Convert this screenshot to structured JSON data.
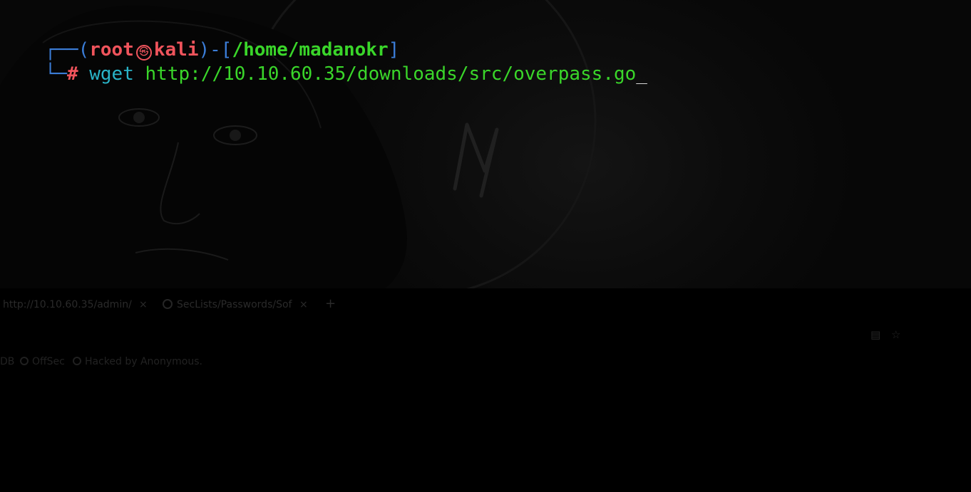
{
  "terminal": {
    "prompt": {
      "corner_top": "┌──(",
      "user": "root",
      "separator_icon": "kali-skull-icon",
      "separator_glyph": "㉿",
      "host": "kali",
      "mid": ")-[",
      "cwd": "/home/madanokr",
      "close": "]",
      "corner_bottom": "└─",
      "hash": "#"
    },
    "command": "wget",
    "argument": "http://10.10.60.35/downloads/src/overpass.go",
    "cursor": "_"
  },
  "browser": {
    "tabs": [
      {
        "label": "http://10.10.60.35/admin/",
        "close": "×"
      },
      {
        "label": "SecLists/Passwords/Sof",
        "close": "×",
        "icon": "github-icon"
      }
    ],
    "new_tab": "+",
    "bookmarks": [
      {
        "label": "DB"
      },
      {
        "label": "OffSec"
      },
      {
        "label": "Hacked by Anonymous."
      }
    ]
  },
  "colors": {
    "background": "#000000",
    "prompt_blue": "#3b7dd8",
    "prompt_red": "#f0545c",
    "prompt_green": "#3ad62a",
    "command_cyan": "#29b3c7"
  }
}
